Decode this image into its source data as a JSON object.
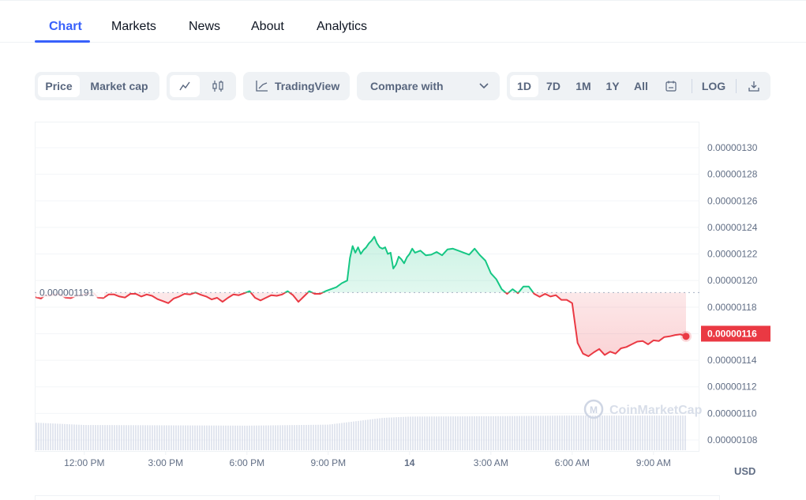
{
  "tabs": [
    {
      "label": "Chart",
      "active": true
    },
    {
      "label": "Markets",
      "active": false
    },
    {
      "label": "News",
      "active": false
    },
    {
      "label": "About",
      "active": false
    },
    {
      "label": "Analytics",
      "active": false
    }
  ],
  "toolbar": {
    "metric_toggle": [
      {
        "label": "Price",
        "active": true
      },
      {
        "label": "Market cap",
        "active": false
      }
    ],
    "chart_type": [
      {
        "icon": "line-chart-icon",
        "active": true
      },
      {
        "icon": "candlestick-icon",
        "active": false
      }
    ],
    "tradingview_label": "TradingView",
    "compare_label": "Compare with",
    "ranges": [
      {
        "label": "1D",
        "active": true
      },
      {
        "label": "7D",
        "active": false
      },
      {
        "label": "1M",
        "active": false
      },
      {
        "label": "1Y",
        "active": false
      },
      {
        "label": "All",
        "active": false
      }
    ],
    "log_label": "LOG",
    "calendar_icon": "calendar-icon",
    "download_icon": "download-icon"
  },
  "colors": {
    "accent": "#3861fb",
    "up": "#16c784",
    "down": "#ea3943",
    "volume": "#cfd6e4"
  },
  "chart_data": {
    "type": "line",
    "title": "",
    "xlabel": "",
    "ylabel": "USD",
    "currency_label": "USD",
    "baseline": 1.191e-06,
    "baseline_label": "0.000001191",
    "current_price": 1.16e-06,
    "current_price_label": "0.00000116",
    "ylim": [
      1.07e-06,
      1.32e-06
    ],
    "yticks": [
      1.3e-06,
      1.28e-06,
      1.26e-06,
      1.24e-06,
      1.22e-06,
      1.2e-06,
      1.18e-06,
      1.16e-06,
      1.14e-06,
      1.12e-06,
      1.1e-06,
      1.08e-06
    ],
    "ytick_labels": [
      "0.00000130",
      "0.00000128",
      "0.00000126",
      "0.00000124",
      "0.00000122",
      "0.00000120",
      "0.00000118",
      "0.00000116",
      "0.00000114",
      "0.00000112",
      "0.00000110",
      "0.00000108"
    ],
    "x_hours_range": [
      -1.8,
      22.2
    ],
    "xticks": [
      0,
      3,
      6,
      9,
      12,
      15,
      18,
      21
    ],
    "xtick_labels": [
      "12:00 PM",
      "3:00 PM",
      "6:00 PM",
      "9:00 PM",
      "14",
      "3:00 AM",
      "6:00 AM",
      "9:00 AM"
    ],
    "watermark": "CoinMarketCap",
    "series": [
      {
        "name": "Price",
        "x_hours": [
          -1.8,
          -1.6,
          -1.45,
          -1.3,
          -1.1,
          -0.9,
          -0.7,
          -0.5,
          -0.3,
          -0.1,
          0.1,
          0.3,
          0.5,
          0.7,
          0.9,
          1.1,
          1.3,
          1.5,
          1.7,
          1.9,
          2.1,
          2.3,
          2.5,
          2.7,
          2.9,
          3.1,
          3.3,
          3.5,
          3.7,
          3.9,
          4.1,
          4.3,
          4.5,
          4.7,
          4.9,
          5.1,
          5.3,
          5.5,
          5.7,
          5.9,
          6.1,
          6.3,
          6.5,
          6.7,
          6.9,
          7.1,
          7.3,
          7.5,
          7.7,
          7.9,
          8.1,
          8.3,
          8.5,
          8.7,
          8.9,
          9.1,
          9.3,
          9.5,
          9.7,
          9.8,
          9.9,
          10.0,
          10.1,
          10.2,
          10.3,
          10.4,
          10.5,
          10.6,
          10.7,
          10.8,
          10.9,
          11.0,
          11.1,
          11.2,
          11.3,
          11.4,
          11.5,
          11.6,
          11.7,
          11.8,
          11.9,
          12.0,
          12.1,
          12.2,
          12.4,
          12.6,
          12.8,
          13.0,
          13.2,
          13.4,
          13.6,
          13.8,
          14.0,
          14.2,
          14.4,
          14.6,
          14.8,
          15.0,
          15.2,
          15.4,
          15.6,
          15.8,
          16.0,
          16.2,
          16.4,
          16.6,
          16.8,
          17.0,
          17.2,
          17.4,
          17.6,
          17.8,
          18.0,
          18.2,
          18.4,
          18.6,
          18.8,
          19.0,
          19.2,
          19.4,
          19.6,
          19.8,
          20.0,
          20.2,
          20.4,
          20.6,
          20.8,
          21.0,
          21.2,
          21.4,
          21.6,
          21.8,
          22.0,
          22.2
        ],
        "values": [
          1.1875,
          1.1865,
          1.1888,
          1.1885,
          1.1895,
          1.1895,
          1.1872,
          1.1868,
          1.1885,
          1.189,
          1.1898,
          1.1915,
          1.1872,
          1.1868,
          1.1895,
          1.1895,
          1.188,
          1.1872,
          1.19,
          1.19,
          1.188,
          1.1895,
          1.1885,
          1.186,
          1.1845,
          1.183,
          1.1865,
          1.188,
          1.19,
          1.1895,
          1.191,
          1.1893,
          1.188,
          1.1858,
          1.187,
          1.184,
          1.187,
          1.1895,
          1.189,
          1.1905,
          1.192,
          1.187,
          1.185,
          1.187,
          1.189,
          1.1885,
          1.1895,
          1.192,
          1.189,
          1.184,
          1.188,
          1.192,
          1.19,
          1.19,
          1.192,
          1.1935,
          1.195,
          1.198,
          1.2,
          1.217,
          1.226,
          1.221,
          1.225,
          1.22,
          1.223,
          1.225,
          1.228,
          1.23,
          1.233,
          1.228,
          1.225,
          1.224,
          1.225,
          1.22,
          1.221,
          1.209,
          1.212,
          1.218,
          1.216,
          1.213,
          1.2175,
          1.22,
          1.224,
          1.221,
          1.2225,
          1.219,
          1.2195,
          1.2215,
          1.219,
          1.2235,
          1.224,
          1.2225,
          1.221,
          1.2195,
          1.224,
          1.219,
          1.215,
          1.2055,
          1.201,
          1.1935,
          1.19,
          1.1935,
          1.1905,
          1.1955,
          1.1955,
          1.19,
          1.1878,
          1.19,
          1.188,
          1.189,
          1.1855,
          1.1855,
          1.183,
          1.153,
          1.145,
          1.143,
          1.146,
          1.1485,
          1.144,
          1.1465,
          1.145,
          1.149,
          1.15,
          1.152,
          1.154,
          1.1545,
          1.152,
          1.155,
          1.1545,
          1.1575,
          1.158,
          1.159,
          1.1595,
          1.158,
          1.158,
          1.156,
          1.16
        ]
      }
    ],
    "volume": {
      "note": "relative volume bars (0-1 scale of panel height)",
      "x_hours": [
        -1.8,
        0.0,
        3.0,
        6.0,
        9.0,
        11.0,
        12.0,
        15.0,
        18.0,
        21.0,
        22.2
      ],
      "values": [
        0.82,
        0.75,
        0.74,
        0.73,
        0.76,
        0.96,
        1.0,
        1.01,
        1.03,
        1.03,
        1.03
      ]
    }
  }
}
